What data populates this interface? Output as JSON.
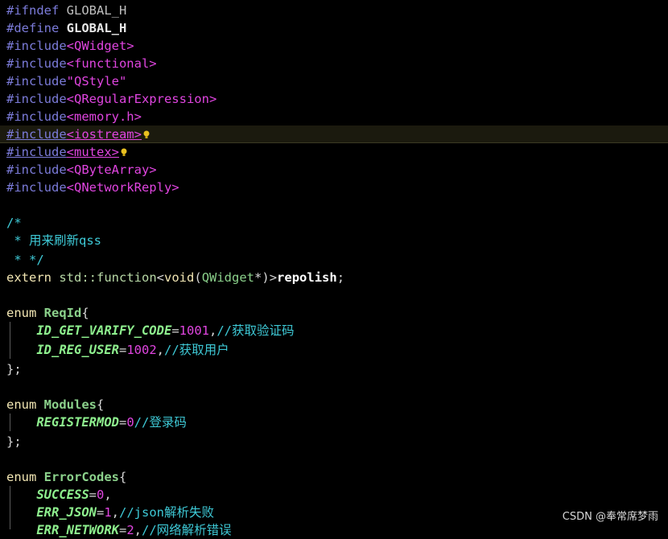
{
  "lines": {
    "l1": {
      "kw": "#ifndef",
      "name": "GLOBAL_H"
    },
    "l2": {
      "kw": "#define",
      "name": "GLOBAL_H"
    },
    "l3": {
      "kw": "#include",
      "arg": "<QWidget>"
    },
    "l4": {
      "kw": "#include",
      "arg": "<functional>"
    },
    "l5": {
      "kw": "#include",
      "arg": "\"QStyle\""
    },
    "l6": {
      "kw": "#include",
      "arg": "<QRegularExpression>"
    },
    "l7": {
      "kw": "#include",
      "arg": "<memory.h>"
    },
    "l8": {
      "kw": "#include",
      "arg": "<iostream>"
    },
    "l9": {
      "kw": "#include",
      "arg": "<mutex>"
    },
    "l10": {
      "kw": "#include",
      "arg": "<QByteArray>"
    },
    "l11": {
      "kw": "#include",
      "arg": "<QNetworkReply>"
    },
    "l13": {
      "text": "/*"
    },
    "l14": {
      "text": " * 用来刷新qss"
    },
    "l15": {
      "text": " * */"
    },
    "l16": {
      "extern": "extern",
      "ns": "std::",
      "fn": "function",
      "lt": "<",
      "vd": "void",
      "lp": "(",
      "qw": "QWidget",
      "star": "*",
      "rp": ")",
      "gt": ">",
      "name": "repolish",
      "semi": ";"
    },
    "l18": {
      "kw": "enum",
      "name": "ReqId",
      "brace": "{"
    },
    "l19": {
      "name": "ID_GET_VARIFY_CODE",
      "eq": "=",
      "val": "1001",
      "comma": ",",
      "comment": "//获取验证码"
    },
    "l20": {
      "name": "ID_REG_USER",
      "eq": "=",
      "val": "1002",
      "comma": ",",
      "comment": "//获取用户"
    },
    "l21": {
      "text": "};"
    },
    "l23": {
      "kw": "enum",
      "name": "Modules",
      "brace": "{"
    },
    "l24": {
      "name": "REGISTERMOD",
      "eq": "=",
      "val": "0",
      "comment": "//登录码"
    },
    "l25": {
      "text": "};"
    },
    "l27": {
      "kw": "enum",
      "name": "ErrorCodes",
      "brace": "{"
    },
    "l28": {
      "name": "SUCCESS",
      "eq": "=",
      "val": "0",
      "comma": ","
    },
    "l29": {
      "name": "ERR_JSON",
      "eq": "=",
      "val": "1",
      "comma": ",",
      "comment": "//json解析失败"
    },
    "l30": {
      "name": "ERR_NETWORK",
      "eq": "=",
      "val": "2",
      "comma": ",",
      "comment": "//网络解析错误"
    }
  },
  "watermark": "CSDN @奉常席梦雨",
  "colors": {
    "background": "#000000",
    "preprocessor": "#7b7bd9",
    "string": "#e045e0",
    "comment": "#3ec9d6",
    "enum_constant": "#8ef08e",
    "current_line": "#1b1a0e"
  },
  "icons": [
    "lightbulb-icon"
  ]
}
